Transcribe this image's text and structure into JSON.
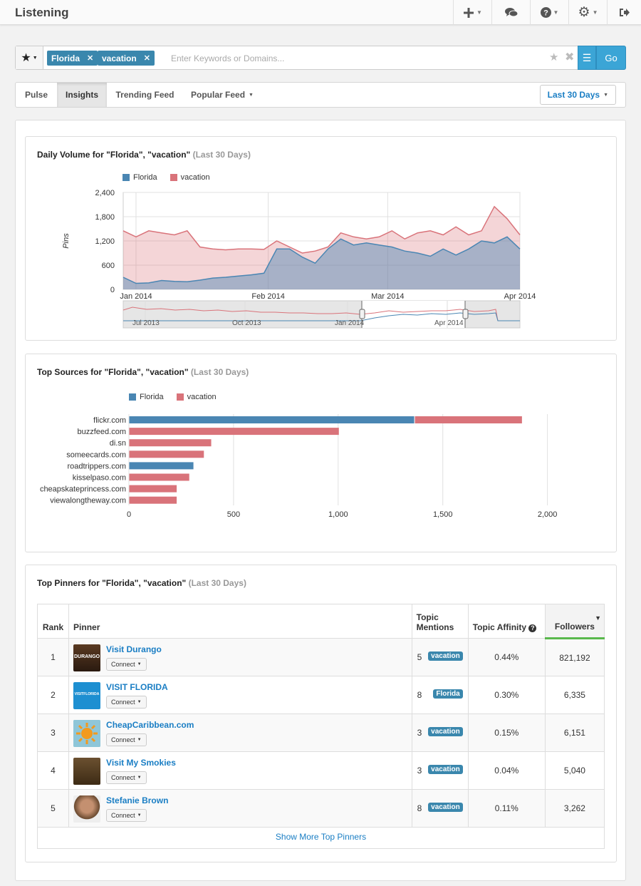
{
  "header": {
    "title": "Listening",
    "icons": [
      "plus-icon",
      "chat-icon",
      "help-icon",
      "gear-icon",
      "logout-icon"
    ]
  },
  "search": {
    "tags": [
      "Florida",
      "vacation"
    ],
    "placeholder": "Enter Keywords or Domains...",
    "go_label": "Go"
  },
  "tabs": {
    "items": [
      "Pulse",
      "Insights",
      "Trending Feed",
      "Popular Feed"
    ],
    "active": "Insights",
    "range_label": "Last 30 Days"
  },
  "colors": {
    "florida": "#4a86b3",
    "vacation": "#d9737a",
    "accent": "#3ba5d6",
    "link": "#1a7ec4"
  },
  "volume": {
    "title": "Daily Volume for \"Florida\", \"vacation\"",
    "subtitle": "(Last 30 Days)",
    "ylabel": "Pins",
    "legend": [
      "Florida",
      "vacation"
    ],
    "ytick_labels": [
      "2,400",
      "1,800",
      "1,200",
      "600",
      "0"
    ],
    "xtick_labels": [
      "Jan 2014",
      "Feb 2014",
      "Mar 2014",
      "Apr 2014"
    ],
    "navigator_labels": [
      "Jul 2013",
      "Oct 2013",
      "Jan 2014",
      "Apr 2014"
    ]
  },
  "sources": {
    "title": "Top Sources for \"Florida\", \"vacation\"",
    "subtitle": "(Last 30 Days)",
    "legend": [
      "Florida",
      "vacation"
    ],
    "xtick_labels": [
      "0",
      "500",
      "1,000",
      "1,500",
      "2,000"
    ]
  },
  "pinners": {
    "title": "Top Pinners for \"Florida\", \"vacation\"",
    "subtitle": "(Last 30 Days)",
    "headers": {
      "rank": "Rank",
      "pinner": "Pinner",
      "mentions": "Topic Mentions",
      "affinity": "Topic Affinity",
      "followers": "Followers"
    },
    "connect_label": "Connect",
    "rows": [
      {
        "rank": "1",
        "name": "Visit Durango",
        "mentions": "5",
        "topic": "vacation",
        "affinity": "0.44%",
        "followers": "821,192",
        "avatar_text": "DURANGO"
      },
      {
        "rank": "2",
        "name": "VISIT FLORIDA",
        "mentions": "8",
        "topic": "Florida",
        "affinity": "0.30%",
        "followers": "6,335",
        "avatar_text": "VISITFLORIDA"
      },
      {
        "rank": "3",
        "name": "CheapCaribbean.com",
        "mentions": "3",
        "topic": "vacation",
        "affinity": "0.15%",
        "followers": "6,151",
        "avatar_text": ""
      },
      {
        "rank": "4",
        "name": "Visit My Smokies",
        "mentions": "3",
        "topic": "vacation",
        "affinity": "0.04%",
        "followers": "5,040",
        "avatar_text": ""
      },
      {
        "rank": "5",
        "name": "Stefanie Brown",
        "mentions": "8",
        "topic": "vacation",
        "affinity": "0.11%",
        "followers": "3,262",
        "avatar_text": ""
      }
    ],
    "show_more": "Show More Top Pinners"
  },
  "chart_data": [
    {
      "type": "area",
      "title": "Daily Volume for \"Florida\", \"vacation\" (Last 30 Days)",
      "xlabel": "",
      "ylabel": "Pins",
      "ylim": [
        0,
        2400
      ],
      "x_range": [
        "2013-12-29",
        "2014-04-01"
      ],
      "x_ticks": [
        "Jan 2014",
        "Feb 2014",
        "Mar 2014",
        "Apr 2014"
      ],
      "stacked": false,
      "legend_position": "top-left",
      "grid": true,
      "x": [
        "2013-12-29",
        "2014-01-01",
        "2014-01-04",
        "2014-01-07",
        "2014-01-10",
        "2014-01-13",
        "2014-01-16",
        "2014-01-19",
        "2014-01-22",
        "2014-01-25",
        "2014-01-28",
        "2014-01-31",
        "2014-02-03",
        "2014-02-06",
        "2014-02-09",
        "2014-02-12",
        "2014-02-15",
        "2014-02-18",
        "2014-02-21",
        "2014-02-24",
        "2014-02-27",
        "2014-03-02",
        "2014-03-05",
        "2014-03-08",
        "2014-03-11",
        "2014-03-14",
        "2014-03-17",
        "2014-03-20",
        "2014-03-23",
        "2014-03-26",
        "2014-03-29",
        "2014-04-01"
      ],
      "series": [
        {
          "name": "Florida",
          "values": [
            300,
            150,
            160,
            220,
            200,
            190,
            230,
            280,
            300,
            330,
            360,
            400,
            1000,
            1000,
            800,
            650,
            1000,
            1250,
            1100,
            1150,
            1100,
            1050,
            950,
            900,
            820,
            1000,
            850,
            1000,
            1200,
            1150,
            1300,
            1000
          ]
        },
        {
          "name": "vacation",
          "values": [
            1450,
            1300,
            1450,
            1400,
            1350,
            1450,
            1050,
            1000,
            980,
            1000,
            1000,
            990,
            1200,
            1050,
            900,
            950,
            1050,
            1400,
            1300,
            1250,
            1300,
            1450,
            1250,
            1400,
            1450,
            1350,
            1550,
            1350,
            1450,
            2050,
            1750,
            1350
          ]
        }
      ]
    },
    {
      "type": "bar",
      "orientation": "horizontal",
      "stacked": true,
      "title": "Top Sources for \"Florida\", \"vacation\" (Last 30 Days)",
      "xlabel": "",
      "ylabel": "",
      "xlim": [
        0,
        2100
      ],
      "legend_position": "top-left",
      "grid": true,
      "categories": [
        "flickr.com",
        "buzzfeed.com",
        "di.sn",
        "someecards.com",
        "roadtrippers.com",
        "kisselpaso.com",
        "cheapskateprincess.com",
        "viewalongtheway.com"
      ],
      "series": [
        {
          "name": "Florida",
          "values": [
            1365,
            0,
            0,
            0,
            310,
            0,
            0,
            0
          ]
        },
        {
          "name": "vacation",
          "values": [
            515,
            1005,
            395,
            360,
            0,
            290,
            230,
            230
          ]
        }
      ]
    }
  ]
}
